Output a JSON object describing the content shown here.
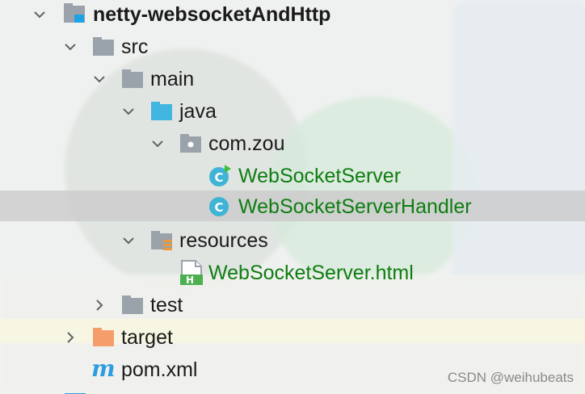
{
  "project_tree": {
    "root": {
      "label": "netty-websocketAndHttp"
    },
    "src": {
      "label": "src"
    },
    "main": {
      "label": "main"
    },
    "java": {
      "label": "java"
    },
    "package": {
      "label": "com.zou"
    },
    "class1": {
      "label": "WebSocketServer"
    },
    "class2": {
      "label": "WebSocketServerHandler"
    },
    "resources": {
      "label": "resources"
    },
    "html_file": {
      "label": "WebSocketServer.html"
    },
    "test": {
      "label": "test"
    },
    "target": {
      "label": "target"
    },
    "pom": {
      "label": "pom.xml"
    }
  },
  "icons": {
    "folder": "folder-icon",
    "source_folder": "source-folder-icon",
    "package": "package-icon",
    "class": "class-icon",
    "resources": "resources-folder-icon",
    "html": "html-file-icon",
    "excluded": "excluded-folder-icon",
    "maven": "maven-icon",
    "module": "module-icon"
  },
  "colors": {
    "text": "#1a1a1a",
    "vcs_added": "#0f7d12",
    "folder_gray": "#9aa3ab",
    "source_blue": "#40b6e0",
    "target_orange": "#f59e6b",
    "class_teal": "#3fb4d6",
    "maven_blue": "#2c9de0"
  },
  "watermark": "CSDN @weihubeats"
}
